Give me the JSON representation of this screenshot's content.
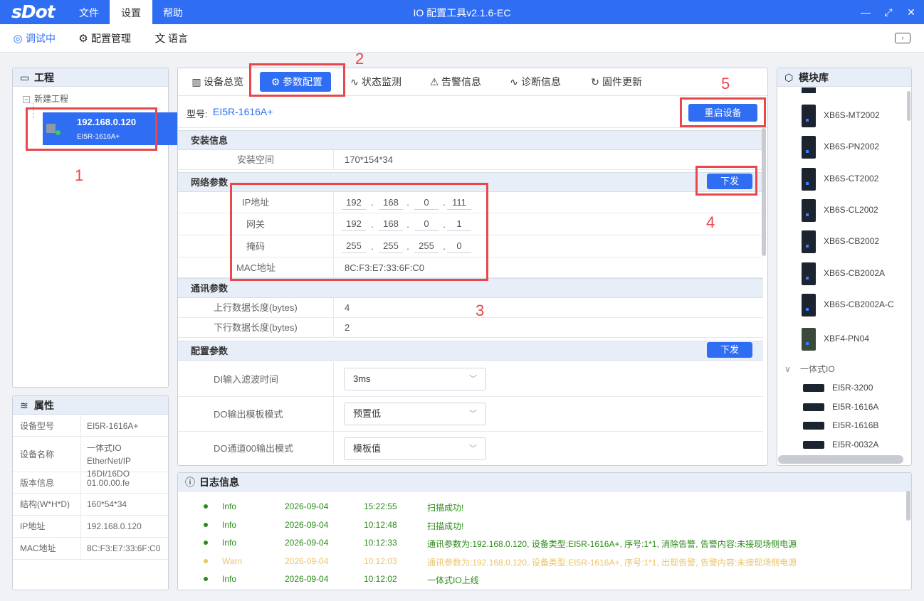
{
  "logo": "sDot",
  "menu": [
    "文件",
    "设置",
    "帮助"
  ],
  "app_title": "IO 配置工具v2.1.6-EC",
  "toolbar": [
    {
      "icon": "eye-off-icon",
      "label": "调试中"
    },
    {
      "icon": "gear-icon",
      "label": "配置管理"
    },
    {
      "icon": "translate-icon",
      "label": "语言"
    }
  ],
  "project": {
    "title": "工程",
    "root": "新建工程",
    "device_ip": "192.168.0.120",
    "device_model": "EI5R-1616A+"
  },
  "properties": {
    "title": "属性",
    "rows": [
      {
        "k": "设备型号",
        "v": "EI5R-1616A+"
      },
      {
        "k": "设备名称",
        "v": "一体式IO EtherNet/IP 16DI/16DO"
      },
      {
        "k": "版本信息",
        "v": "01.00.00.fe"
      },
      {
        "k": "结构(W*H*D)",
        "v": "160*54*34"
      },
      {
        "k": "IP地址",
        "v": "192.168.0.120"
      },
      {
        "k": "MAC地址",
        "v": "8C:F3:E7:33:6F:C0"
      }
    ]
  },
  "tabs": [
    "设备总览",
    "参数配置",
    "状态监测",
    "告警信息",
    "诊断信息",
    "固件更新"
  ],
  "model": {
    "label": "型号:",
    "value": "EI5R-1616A+"
  },
  "restart_button": "重启设备",
  "install": {
    "title": "安装信息",
    "k": "安装空间",
    "v": "170*154*34"
  },
  "network": {
    "title": "网络参数",
    "send": "下发",
    "ip_label": "IP地址",
    "ip": [
      "192",
      "168",
      "0",
      "111"
    ],
    "gw_label": "网关",
    "gw": [
      "192",
      "168",
      "0",
      "1"
    ],
    "mask_label": "掩码",
    "mask": [
      "255",
      "255",
      "255",
      "0"
    ],
    "mac_label": "MAC地址",
    "mac": "8C:F3:E7:33:6F:C0"
  },
  "comm": {
    "title": "通讯参数",
    "up_label": "上行数据长度(bytes)",
    "up": "4",
    "down_label": "下行数据长度(bytes)",
    "down": "2"
  },
  "config": {
    "title": "配置参数",
    "send": "下发",
    "items": [
      {
        "k": "DI输入滤波时间",
        "v": "3ms"
      },
      {
        "k": "DO输出模板模式",
        "v": "预置低"
      },
      {
        "k": "DO通道00输出模式",
        "v": "模板值"
      }
    ]
  },
  "library": {
    "title": "模块库",
    "modules": [
      "XB6S-MT2002",
      "XB6S-PN2002",
      "XB6S-CT2002",
      "XB6S-CL2002",
      "XB6S-CB2002",
      "XB6S-CB2002A",
      "XB6S-CB2002A-C",
      "XBF4-PN04"
    ],
    "group": "一体式IO",
    "io_modules": [
      "EI5R-3200",
      "EI5R-1616A",
      "EI5R-1616B",
      "EI5R-0032A"
    ]
  },
  "log": {
    "title": "日志信息",
    "rows": [
      {
        "level": "Info",
        "date": "2026-09-04",
        "time": "15:22:55",
        "msg": "扫描成功!"
      },
      {
        "level": "Info",
        "date": "2026-09-04",
        "time": "10:12:48",
        "msg": "扫描成功!"
      },
      {
        "level": "Info",
        "date": "2026-09-04",
        "time": "10:12:33",
        "msg": "通讯参数为:192.168.0.120, 设备类型:EI5R-1616A+, 序号:1*1, 消除告警, 告警内容:未接现场侧电源"
      },
      {
        "level": "Warn",
        "date": "2026-09-04",
        "time": "10:12:03",
        "msg": "通讯参数为:192.168.0.120, 设备类型:EI5R-1616A+, 序号:1*1, 出现告警, 告警内容:未接现场侧电源"
      },
      {
        "level": "Info",
        "date": "2026-09-04",
        "time": "10:12:02",
        "msg": "一体式IO上线"
      }
    ]
  },
  "annotations": [
    "1",
    "2",
    "3",
    "4",
    "5"
  ],
  "colors": {
    "accent": "#2f6ef3",
    "annotation": "#e8474b",
    "info": "#2b8a18",
    "warn": "#e9c46a"
  }
}
